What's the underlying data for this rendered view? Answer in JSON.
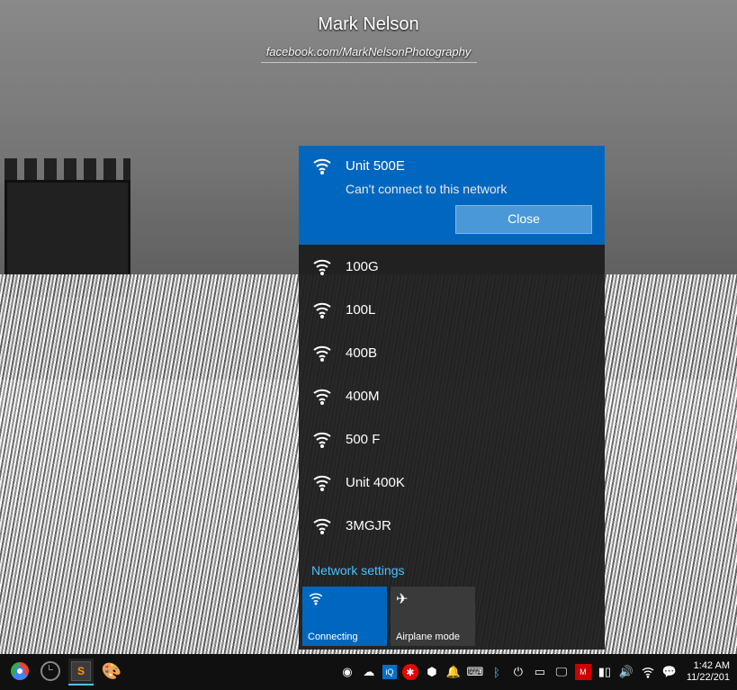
{
  "wallpaper": {
    "artist": "Mark Nelson",
    "credit": "facebook.com/MarkNelsonPhotography"
  },
  "network_flyout": {
    "selected": {
      "name": "Unit 500E",
      "message": "Can't connect to this network",
      "close_label": "Close"
    },
    "networks": [
      {
        "name": "100G"
      },
      {
        "name": "100L"
      },
      {
        "name": "400B"
      },
      {
        "name": "400M"
      },
      {
        "name": "500 F"
      },
      {
        "name": "Unit 400K"
      },
      {
        "name": "3MGJR"
      }
    ],
    "settings_link": "Network settings",
    "tiles": {
      "wifi": {
        "label": "Connecting",
        "active": true
      },
      "airplane": {
        "label": "Airplane mode",
        "active": false
      }
    }
  },
  "taskbar": {
    "apps": [
      {
        "id": "chrome",
        "label": "Google Chrome"
      },
      {
        "id": "clock",
        "label": "Clock"
      },
      {
        "id": "sublime",
        "label": "Sublime Text",
        "running": true
      },
      {
        "id": "paint",
        "label": "Paint"
      }
    ],
    "tray_icons": [
      "logitech",
      "onedrive",
      "intel",
      "malware",
      "dropbox",
      "notifications",
      "input",
      "bluetooth",
      "power",
      "touchpad",
      "display",
      "antivirus",
      "battery",
      "volume",
      "wifi",
      "action-center"
    ],
    "clock": {
      "time": "1:42 AM",
      "date": "11/22/201"
    }
  },
  "colors": {
    "accent": "#0067c0",
    "link": "#4cc2ff"
  }
}
